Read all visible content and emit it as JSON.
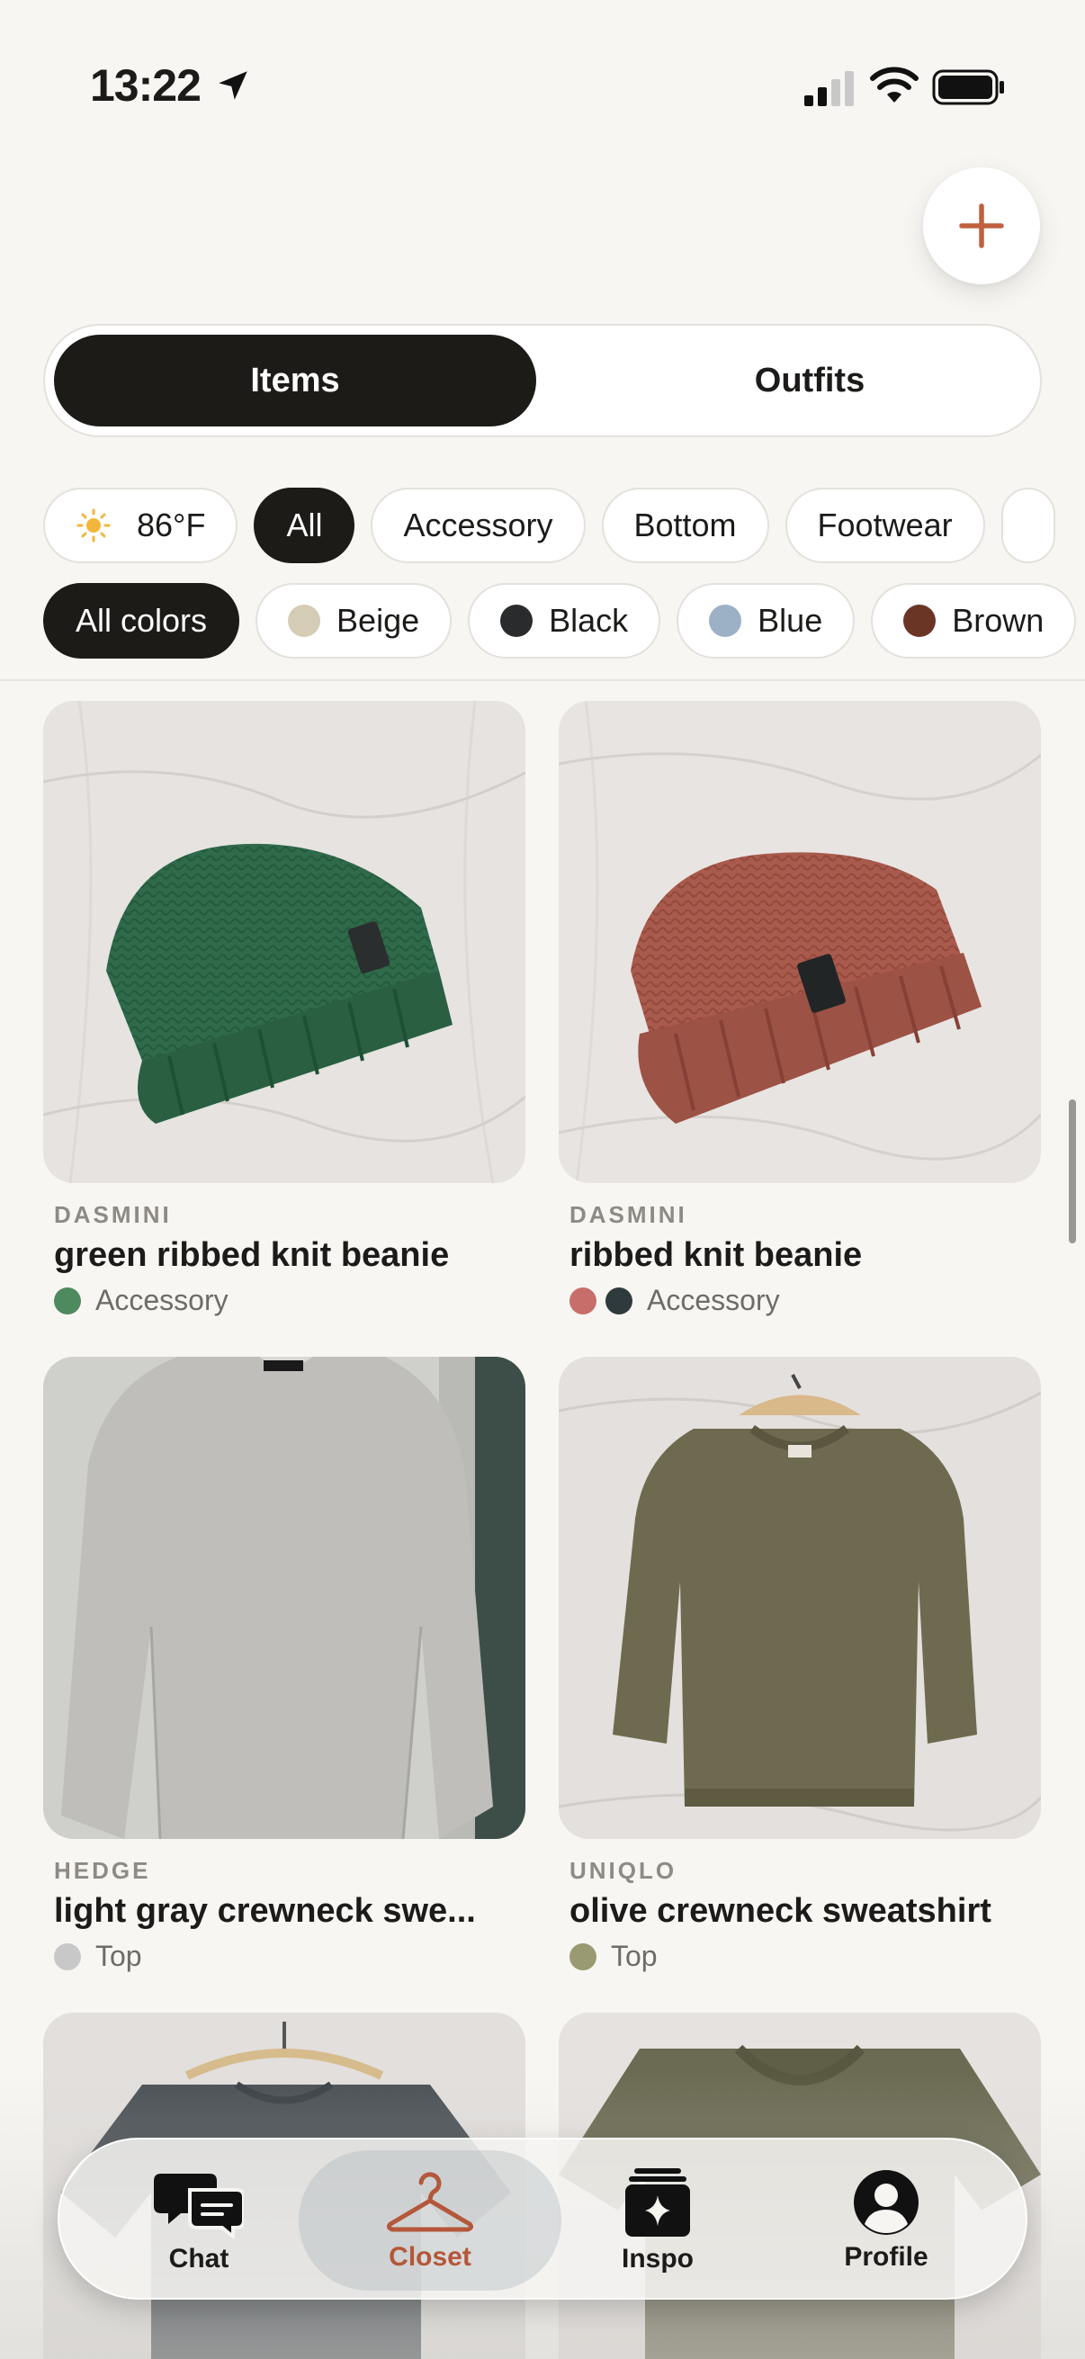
{
  "status_bar": {
    "time": "13:22"
  },
  "header": {
    "add_icon": "plus-icon"
  },
  "segment": {
    "items_label": "Items",
    "outfits_label": "Outfits",
    "selected": "Items"
  },
  "filters": {
    "weather": {
      "icon": "sun-icon",
      "label": "86°F"
    },
    "categories": [
      "All",
      "Accessory",
      "Bottom",
      "Footwear"
    ],
    "selected_category": "All",
    "colors": [
      {
        "label": "All colors",
        "selected": true
      },
      {
        "label": "Beige",
        "swatch": "#d4ccb4"
      },
      {
        "label": "Black",
        "swatch": "#2a2b2c"
      },
      {
        "label": "Blue",
        "swatch": "#9cb1c6"
      },
      {
        "label": "Brown",
        "swatch": "#6b3526"
      }
    ]
  },
  "items": [
    {
      "brand": "DASMINI",
      "name": "green ribbed knit beanie",
      "category": "Accessory",
      "colors": [
        "#4e8a5e"
      ]
    },
    {
      "brand": "DASMINI",
      "name": "ribbed knit beanie",
      "category": "Accessory",
      "colors": [
        "#c86e6a",
        "#2f3a3c"
      ]
    },
    {
      "brand": "HEDGE",
      "name": "light gray crewneck swe...",
      "category": "Top",
      "colors": [
        "#c8c8c8"
      ]
    },
    {
      "brand": "UNIQLO",
      "name": "olive crewneck sweatshirt",
      "category": "Top",
      "colors": [
        "#9a9a72"
      ]
    }
  ],
  "tab_bar": {
    "tabs": [
      {
        "label": "Chat",
        "icon": "chat-bubbles-icon"
      },
      {
        "label": "Closet",
        "icon": "hanger-icon",
        "active": true
      },
      {
        "label": "Inspo",
        "icon": "sparkle-cards-icon"
      },
      {
        "label": "Profile",
        "icon": "person-icon"
      }
    ]
  },
  "colors": {
    "accent": "#c0603f",
    "active_tab_label": "#b4573b",
    "chip_active": "#1d1b18",
    "background": "#f8f6f2"
  }
}
